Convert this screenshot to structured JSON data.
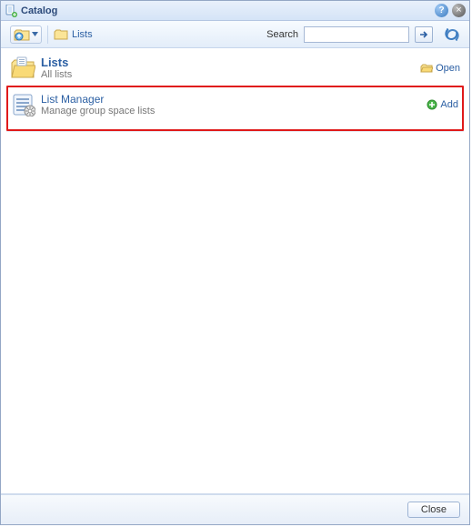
{
  "window": {
    "title": "Catalog"
  },
  "toolbar": {
    "breadcrumb": "Lists",
    "search_label": "Search"
  },
  "category": {
    "name": "Lists",
    "desc": "All lists",
    "open_label": "Open"
  },
  "item": {
    "name": "List Manager",
    "desc": "Manage group space lists",
    "add_label": "Add"
  },
  "footer": {
    "close_label": "Close"
  }
}
